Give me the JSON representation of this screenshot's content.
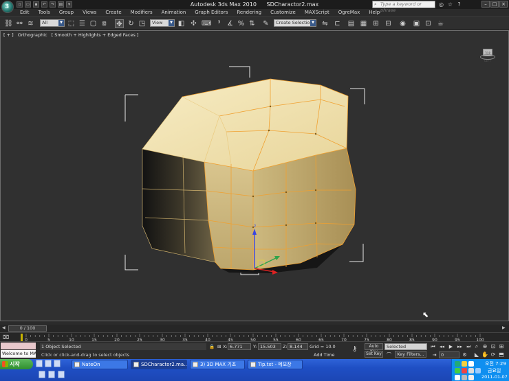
{
  "titlebar": {
    "app_name": "Autodesk 3ds Max  2010",
    "file_name": "SDCharactor2.max",
    "search_placeholder": "Type a keyword or phrase",
    "logo_letter": "3"
  },
  "menu": [
    "Edit",
    "Tools",
    "Group",
    "Views",
    "Create",
    "Modifiers",
    "Animation",
    "Graph Editors",
    "Rendering",
    "Customize",
    "MAXScript",
    "OgreMax",
    "Help"
  ],
  "toolbar": {
    "selection_filter": "All",
    "reference_coord": "View",
    "named_selection": "Create Selection Se"
  },
  "viewport": {
    "label_parts": [
      "[ + ]",
      "Orthographic",
      "[ Smooth + Highlights + Edged Faces ]"
    ],
    "viewcube_label": "TOP LEFT"
  },
  "timeline": {
    "slider_label": "0 / 100",
    "ticks": [
      "0",
      "5",
      "10",
      "15",
      "20",
      "25",
      "30",
      "35",
      "40",
      "45",
      "50",
      "55",
      "60",
      "65",
      "70",
      "75",
      "80",
      "85",
      "90",
      "95",
      "100"
    ]
  },
  "status": {
    "listener_text": "Welcome to MA",
    "selection": "1 Object Selected",
    "prompt": "Click or click-and-drag to select objects",
    "x_label": "X:",
    "x_value": "6.771",
    "y_label": "Y:",
    "y_value": "15.503",
    "z_label": "Z:",
    "z_value": "8.144",
    "grid": "Grid = 10.0",
    "add_time_tag": "Add Time Tag",
    "auto_key": "Auto Key",
    "set_key": "Set Key",
    "selected_dropdown": "Selected",
    "key_filters": "Key Filters...",
    "current_frame": "0"
  },
  "taskbar": {
    "start_label": "시작",
    "tasks": [
      {
        "label": "NateOn",
        "active": false
      },
      {
        "label": "SDCharactor2.ma...",
        "active": true
      },
      {
        "label": "3) 3D MAX 기초",
        "active": false
      },
      {
        "label": "Tip.txt - 메모장",
        "active": false
      }
    ],
    "tray_time": "오전 7:29",
    "tray_day": "금요일",
    "tray_date": "2011-01-07"
  },
  "colors": {
    "viewport_bg": "#303030",
    "mesh_light": "#f3e4b0",
    "mesh_mid": "#c9b47e",
    "mesh_dark": "#1a1a1a",
    "wire": "#f0a030",
    "taskbar": "#245edb"
  }
}
